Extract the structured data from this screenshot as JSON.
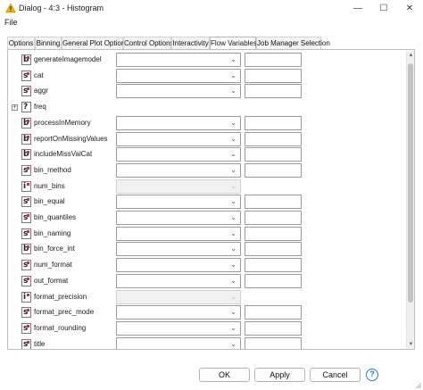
{
  "window": {
    "title": "Dialog - 4:3 - Histogram",
    "minimize_glyph": "—",
    "maximize_glyph": "☐",
    "close_glyph": "✕"
  },
  "menu": {
    "file": "File"
  },
  "tabs": [
    {
      "label": "Options",
      "active": false
    },
    {
      "label": "Binning",
      "active": false
    },
    {
      "label": "General Plot Options",
      "active": false
    },
    {
      "label": "Control Options",
      "active": false
    },
    {
      "label": "Interactivity",
      "active": false
    },
    {
      "label": "Flow Variables",
      "active": true
    },
    {
      "label": "Job Manager Selection",
      "active": false
    }
  ],
  "flow_variables": [
    {
      "type": "b",
      "name": "generateImagemodel",
      "expander": false,
      "disabled": false,
      "has_combo": true
    },
    {
      "type": "s",
      "name": "cat",
      "expander": false,
      "disabled": false,
      "has_combo": true
    },
    {
      "type": "s",
      "name": "aggr",
      "expander": false,
      "disabled": false,
      "has_combo": true
    },
    {
      "type": "?",
      "name": "freq",
      "expander": true,
      "expander_glyph": "+",
      "disabled": false,
      "has_combo": false
    },
    {
      "type": "b",
      "name": "processInMemory",
      "expander": false,
      "disabled": false,
      "has_combo": true
    },
    {
      "type": "b",
      "name": "reportOnMissingValues",
      "expander": false,
      "disabled": false,
      "has_combo": true
    },
    {
      "type": "b",
      "name": "includeMissValCat",
      "expander": false,
      "disabled": false,
      "has_combo": true
    },
    {
      "type": "s",
      "name": "bin_method",
      "expander": false,
      "disabled": false,
      "has_combo": true
    },
    {
      "type": "i",
      "name": "num_bins",
      "expander": false,
      "disabled": true,
      "has_combo": true
    },
    {
      "type": "s",
      "name": "bin_equal",
      "expander": false,
      "disabled": false,
      "has_combo": true
    },
    {
      "type": "s",
      "name": "bin_quantiles",
      "expander": false,
      "disabled": false,
      "has_combo": true
    },
    {
      "type": "s",
      "name": "bin_naming",
      "expander": false,
      "disabled": false,
      "has_combo": true
    },
    {
      "type": "b",
      "name": "bin_force_int",
      "expander": false,
      "disabled": false,
      "has_combo": true
    },
    {
      "type": "s",
      "name": "num_format",
      "expander": false,
      "disabled": false,
      "has_combo": true
    },
    {
      "type": "s",
      "name": "out_format",
      "expander": false,
      "disabled": false,
      "has_combo": true
    },
    {
      "type": "i",
      "name": "format_precision",
      "expander": false,
      "disabled": true,
      "has_combo": true
    },
    {
      "type": "s",
      "name": "format_prec_mode",
      "expander": false,
      "disabled": false,
      "has_combo": true
    },
    {
      "type": "s",
      "name": "format_rounding",
      "expander": false,
      "disabled": false,
      "has_combo": true
    },
    {
      "type": "s",
      "name": "title",
      "expander": false,
      "disabled": false,
      "has_combo": true
    }
  ],
  "combo_chevron": "⌄",
  "scroll_up_glyph": "▲",
  "scroll_down_glyph": "▼",
  "footer": {
    "ok": "OK",
    "apply": "Apply",
    "cancel": "Cancel",
    "help": "?"
  },
  "colors": {
    "accent": "#2d78d2",
    "type_marker": "#d23030",
    "warning_icon": "#f2b200"
  },
  "icons": {
    "app": "warning-triangle-icon",
    "help": "help-icon"
  }
}
